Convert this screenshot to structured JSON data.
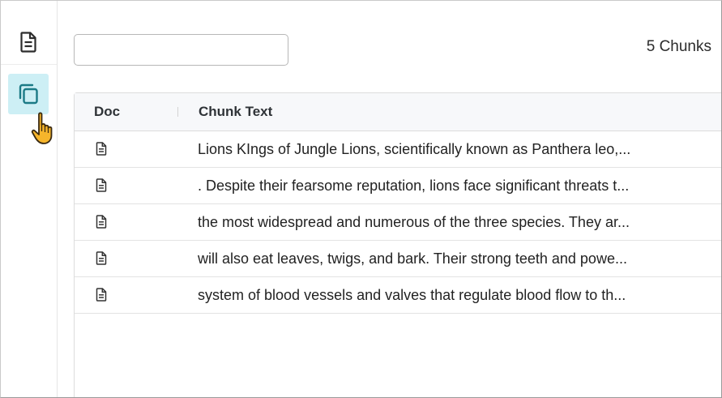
{
  "search": {
    "value": "",
    "placeholder": ""
  },
  "chunk_count_label": "5 Chunks",
  "sidebar": {
    "items": [
      {
        "icon": "document-icon",
        "active": false
      },
      {
        "icon": "copy-icon",
        "active": true
      }
    ],
    "active_color": "#cdeff5",
    "accent": "#1b7a86"
  },
  "table": {
    "columns": [
      "Doc",
      "Chunk Text"
    ],
    "rows": [
      {
        "doc_icon": "document-icon",
        "text": "Lions KIngs of Jungle Lions, scientifically known as Panthera leo,..."
      },
      {
        "doc_icon": "document-icon",
        "text": ". Despite their fearsome reputation, lions face significant threats t..."
      },
      {
        "doc_icon": "document-icon",
        "text": "the most widespread and numerous of the three species. They ar..."
      },
      {
        "doc_icon": "document-icon",
        "text": "will also eat leaves, twigs, and bark. Their strong teeth and powe..."
      },
      {
        "doc_icon": "document-icon",
        "text": "system of blood vessels and valves that regulate blood flow to th..."
      }
    ]
  }
}
